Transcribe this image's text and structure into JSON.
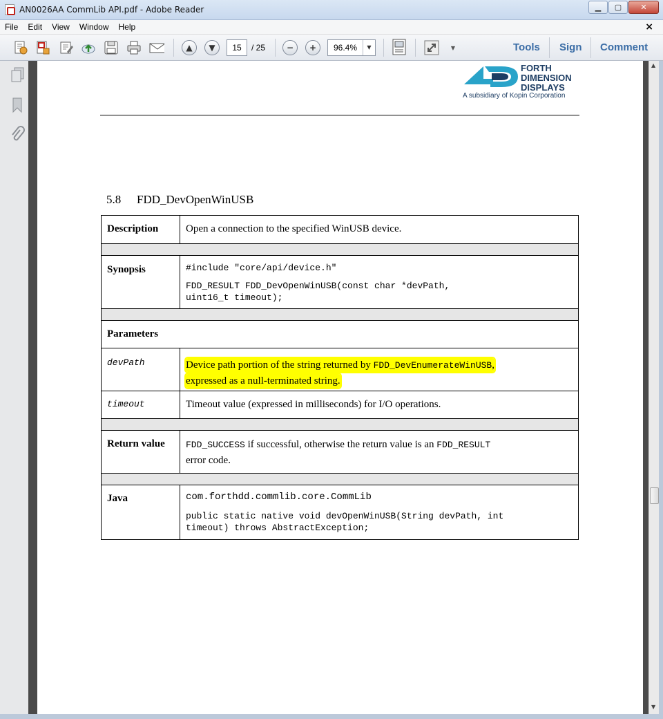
{
  "window": {
    "title": "AN0026AA CommLib API.pdf - Adobe Reader",
    "minimize": "▁",
    "maximize": "▢",
    "close": "✕"
  },
  "menu": {
    "items": [
      "File",
      "Edit",
      "View",
      "Window",
      "Help"
    ],
    "close": "×"
  },
  "toolbar": {
    "page_current": "15",
    "page_total": "/ 25",
    "zoom": "96.4%",
    "tools": "Tools",
    "sign": "Sign",
    "comment": "Comment"
  },
  "document": {
    "logo_line1": "FORTH",
    "logo_line2": "DIMENSION",
    "logo_line3": "DISPLAYS",
    "logo_sub": "A subsidiary of Kopin Corporation",
    "section_number": "5.8",
    "section_title": "FDD_DevOpenWinUSB",
    "description_label": "Description",
    "description_text": "Open a connection to the specified WinUSB device.",
    "synopsis_label": "Synopsis",
    "synopsis_include": "#include \"core/api/device.h\"",
    "synopsis_sig_line1": "FDD_RESULT FDD_DevOpenWinUSB(const char *devPath,",
    "synopsis_sig_line2": "uint16_t timeout);",
    "parameters_label": "Parameters",
    "param1_name": "devPath",
    "param1_text_a": "Device path portion of the string returned by ",
    "param1_code": "FDD_DevEnumerateWinUSB",
    "param1_text_b": ",",
    "param1_text_c": "expressed as a null-terminated string.",
    "param2_name": "timeout",
    "param2_text": "Timeout value (expressed in milliseconds) for I/O operations.",
    "return_label": "Return value",
    "return_code1": "FDD_SUCCESS",
    "return_text1": " if successful, otherwise the return value is an ",
    "return_code2": "FDD_RESULT",
    "return_text2": "error code.",
    "java_label": "Java",
    "java_class": "com.forthdd.commlib.core.CommLib",
    "java_sig_line1": "public static native void devOpenWinUSB(String devPath, int",
    "java_sig_line2": "timeout) throws AbstractException;"
  },
  "icons": [
    "pdf-doc-icon",
    "create-icon",
    "export-icon",
    "edit-icon",
    "upload-icon",
    "save-icon",
    "print-icon",
    "mail-icon",
    "prev-page-icon",
    "next-page-icon",
    "zoom-out-icon",
    "zoom-in-icon",
    "fit-page-icon",
    "fullscreen-icon",
    "pages-icon",
    "bookmark-icon",
    "attachment-icon"
  ],
  "colors": {
    "highlight": "#ffff00",
    "link_blue": "#3b6da6",
    "logo_navy": "#1d3d63",
    "logo_teal": "#29a3c9"
  }
}
